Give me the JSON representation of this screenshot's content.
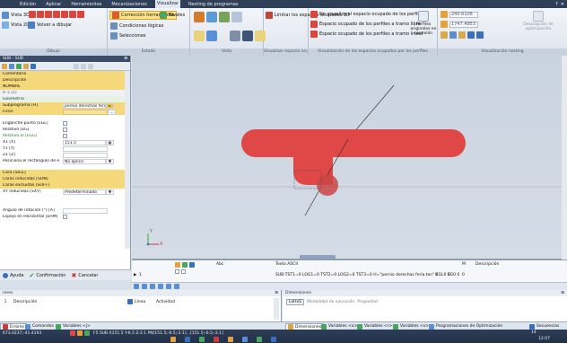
{
  "menubar": {
    "items": [
      "Edición",
      "Aplicar",
      "Herramientas",
      "Mecanizaciones",
      "Visualizar",
      "Nesting de programas"
    ],
    "active_index": 4,
    "right_glyphs": [
      "?",
      "✕"
    ]
  },
  "ribbon": {
    "vista3d": "Vista 3D",
    "vista2d": "Vista 2D",
    "volver": "Volver a dibujar",
    "g1_title": "Dibujo",
    "correccion": "Corrección herramienta",
    "niveles": "Niveles",
    "condiciones": "Condiciones lógicas",
    "selecciones": "Selecciones",
    "g2_title": "Estado",
    "g3_title": "Vista",
    "limitar": "Limitar los espacios ocupados 3D",
    "g4_title": "Visualizar espacio ocupado",
    "novisualiza": "No visualiza el espacio ocupado de los perfiles",
    "tramo_libre": "Espacio ocupado de los perfiles a tramo libre",
    "tramo_lineal": "Espacio ocupado de los perfiles a tramo lineal",
    "perfiles_btn": "Perfiles originales en conexión",
    "g5_title": "Visualización de los espacios ocupados por los perfiles",
    "num1": "240.6106",
    "num2": "1747.4953",
    "g6_title": "Visualización nesting",
    "optim": "Descripción de optimización"
  },
  "leftpanel": {
    "title": "SUB - SUB",
    "pin": "⊞",
    "rows": {
      "comentario": "Comentario",
      "descripcion": "Descripción",
      "nombre": "NOMBRE",
      "ifl": "IF L (1)",
      "geometria": "Geometría",
      "subprograma_label": "Subprograma [H]",
      "subprograma_value": "pernio derechas feria.ton",
      "ficon": "Ficon",
      "enganche": "Enganche punto [EGL]",
      "relativo_eg": "Relativo [EG]",
      "relativo_egg": "Relativo al [EGG]",
      "x_label": "X1 [X]",
      "x_value": "151.5",
      "y_label": "Y1 [Y]",
      "z_label": "Z1 [Z]",
      "posiciona_label": "Posiciona el rectángulo de e",
      "posiciona_value": "No aplica",
      "cara": "Cara [SICE]",
      "caras_inc": "Caras inducidas [SON]",
      "caras_exc": "Caras excluidas [SOFF]",
      "xy_label": "XY Inducidas [SXY]",
      "xy_value": "Predeterminado",
      "angulo": "Ángulo de rotación (°) [A]",
      "espejo": "Espejo en Horizontal [EHM]"
    },
    "bottom": {
      "ayuda": "Ayuda",
      "confirmacion": "Confirmación",
      "cancelar": "Cancelar"
    }
  },
  "viewport": {
    "axis_y": "Y",
    "axis_x": "X"
  },
  "grid": {
    "headers": [
      "Abc",
      "Texto ASCII",
      "M",
      "Descripción"
    ],
    "row_num": "1",
    "row_text": "SUB:TST1=0 LOG1=0 TST2=0 LOG2=0 TST3=0 H=\"pernio derechas feria.ton\" EGL0 EG0 0",
    "row_vals": [
      "0",
      "0",
      "0"
    ]
  },
  "errpanel": {
    "title": "rores",
    "header_num": "",
    "header_desc": "Descripción",
    "linea_label": "Línea",
    "actividad_label": "Actividad",
    "row_num": "1"
  },
  "dimpanel": {
    "title": "Dimensiones",
    "btn_label": "LxHxS",
    "modalidad": "Modalidad de ejecución",
    "propiedad": "Propiedad"
  },
  "tabs_left": [
    {
      "label": "Errores"
    },
    {
      "label": "Comandos"
    },
    {
      "label": "Variables <j>"
    }
  ],
  "tabs_right": [
    {
      "label": "Dimensiones"
    },
    {
      "label": "Variables <o>"
    },
    {
      "label": "Variables <r>"
    },
    {
      "label": "Variables <s>"
    },
    {
      "label": "Programaciones de Optimización"
    },
    {
      "label": "Secuencias"
    }
  ],
  "statusbar": {
    "coords": "673.0237;-41.4193",
    "info": "F5 SUB X151.5 Y-6.5 Z-2.1 PN[151.5;-6.5;-2.1]...[151.5;-6.5;-2.1]",
    "right_count": "14",
    "time": "12:07"
  },
  "colors": {
    "part_red": "#e04848",
    "part_red_dark": "#c63030",
    "accent_blue": "#2f3f57",
    "highlight": "#f4d879"
  }
}
